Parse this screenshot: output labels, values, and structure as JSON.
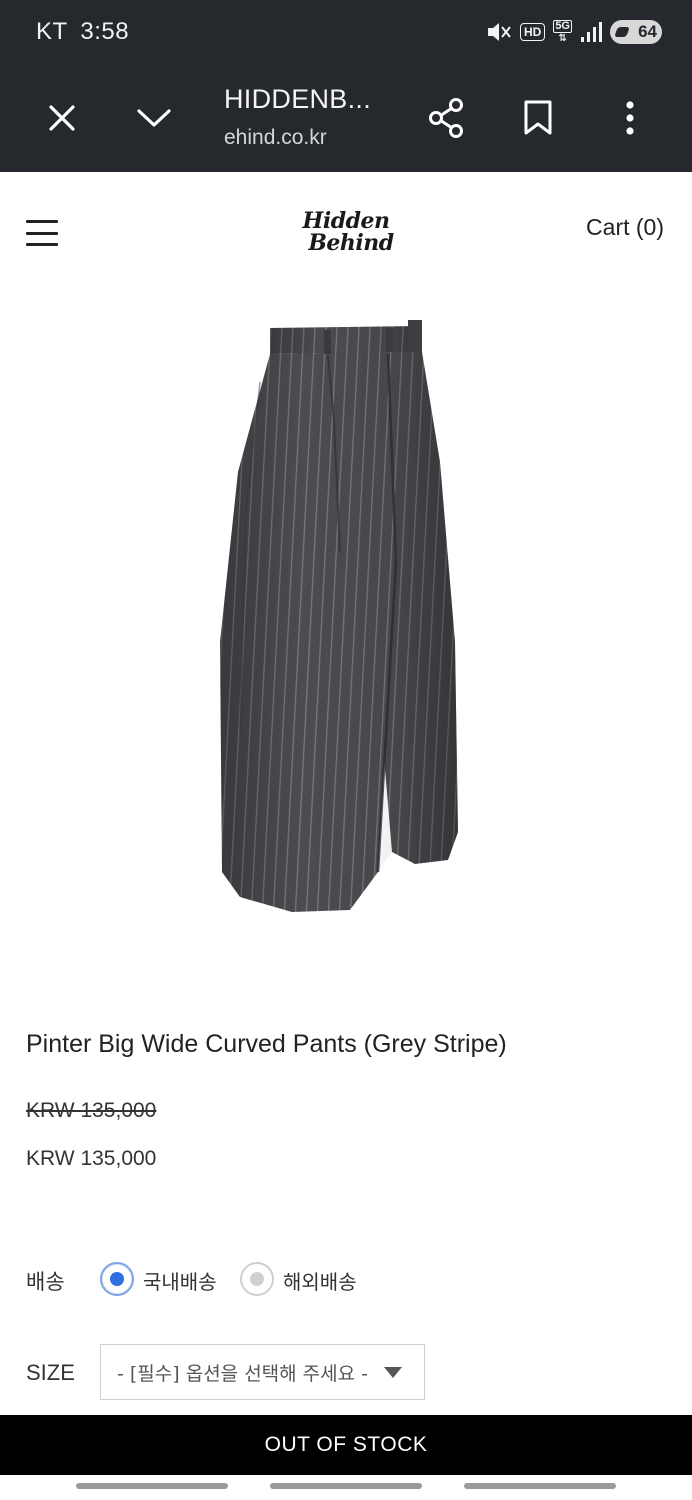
{
  "status_bar": {
    "carrier": "KT",
    "time": "3:58",
    "network": "5G",
    "hd_label": "HD",
    "battery": "64"
  },
  "browser": {
    "page_title": "HIDDENB...",
    "domain": "ehind.co.kr"
  },
  "site": {
    "logo_line1": "Hidden",
    "logo_line2": "Behind",
    "cart_label": "Cart (0)"
  },
  "product": {
    "name": "Pinter Big Wide Curved Pants (Grey Stripe)",
    "price_original": "KRW 135,000",
    "price_sale": "KRW 135,000"
  },
  "shipping": {
    "label": "배송",
    "options": [
      {
        "label": "국내배송",
        "selected": true
      },
      {
        "label": "해외배송",
        "selected": false
      }
    ]
  },
  "size": {
    "label": "SIZE",
    "selected_text": "- [필수] 옵션을 선택해 주세요 -"
  },
  "buy_button": "OUT OF STOCK",
  "colors": {
    "browser_bar": "#25282d",
    "radio_selected": "#2f6fdf",
    "buy_bar": "#000000",
    "product_fabric": "#4a4b4e"
  },
  "icons": {
    "close": "close-icon",
    "collapse": "chevron-down-icon",
    "share": "share-icon",
    "bookmark": "bookmark-icon",
    "menu": "more-vertical-icon"
  }
}
